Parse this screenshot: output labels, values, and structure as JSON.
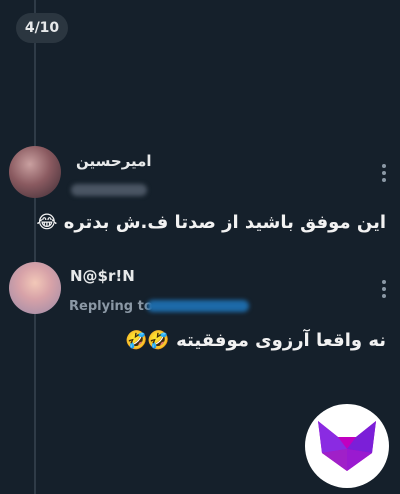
{
  "pager": {
    "label": "4/10"
  },
  "replies": [
    {
      "username": "امیرحسین",
      "text": "این موفق باشید از صدتا ف.ش بدتره 😂"
    },
    {
      "username": "N@$r!N",
      "replying_label": "Replying to",
      "text": "نه واقعا آرزوی موفقیته 🤣🤣"
    }
  ],
  "colors": {
    "background": "#15202b",
    "text": "#e7e9ea",
    "secondary_text": "#8b98a5",
    "logo_purple": "#8a2be2",
    "logo_magenta": "#c000c0"
  },
  "icons": [
    "more-options-icon",
    "fox-logo-icon"
  ]
}
